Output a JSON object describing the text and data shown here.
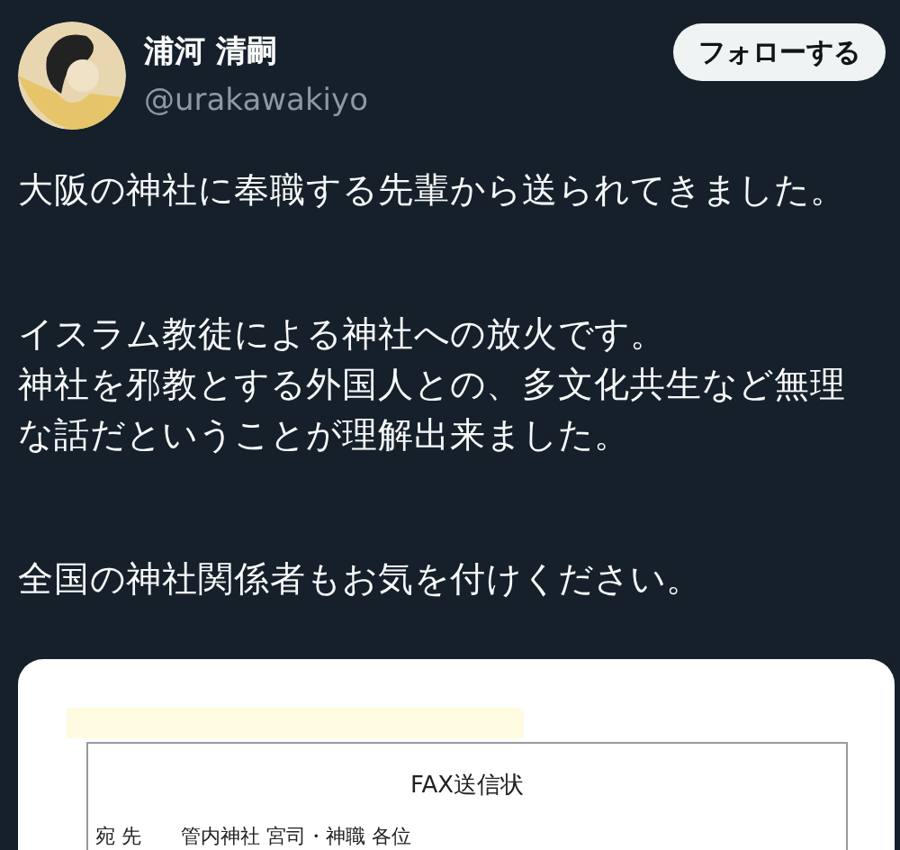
{
  "author": {
    "name": "浦河 清嗣",
    "handle": "@urakawakiyo"
  },
  "follow_button": "フォローする",
  "paragraphs": [
    [
      "大阪の神社に奉職する先輩から送られてきました。"
    ],
    [
      "イスラム教徒による神社への放火です。",
      "神社を邪教とする外国人との、多文化共生など無理",
      "な話だということが理解出来ました。"
    ],
    [
      "全国の神社関係者もお気を付けください。"
    ]
  ],
  "attachment": {
    "title": "FAX送信状",
    "recipient_label": "宛 先",
    "recipient": "管内神社 宮司・神職 各位"
  }
}
